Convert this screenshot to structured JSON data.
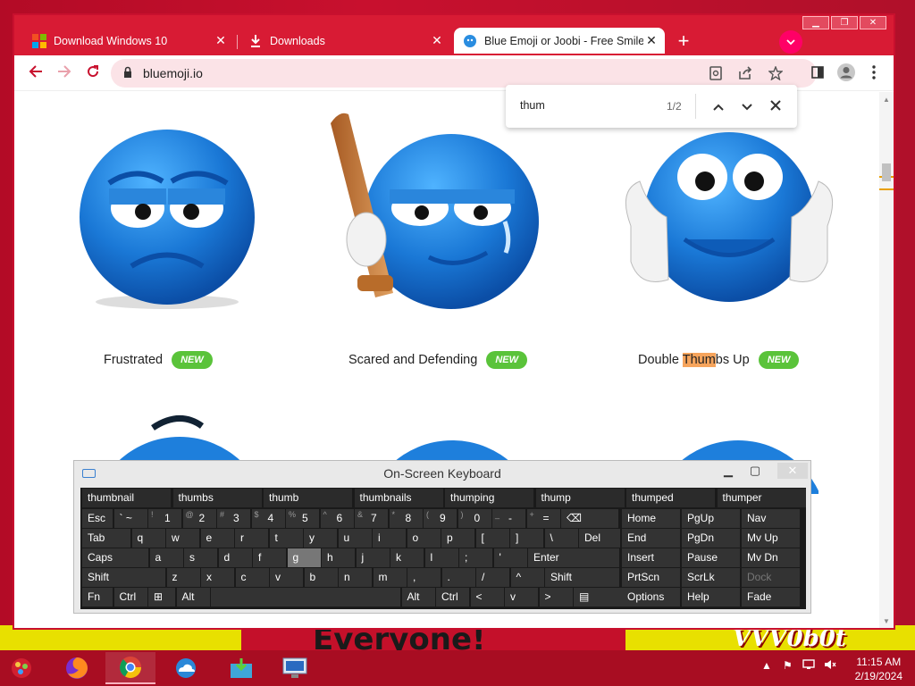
{
  "browser": {
    "tabs": [
      {
        "label": "Download Windows 10",
        "icon": "windows-logo-icon"
      },
      {
        "label": "Downloads",
        "icon": "download-icon"
      },
      {
        "label": "Blue Emoji or Joobi - Free Smiley",
        "icon": "bluemoji-icon",
        "active": true
      }
    ],
    "url": "bluemoji.io",
    "accent": "#d81b34"
  },
  "find_bar": {
    "query": "thum",
    "count": "1/2"
  },
  "page": {
    "items": [
      {
        "name": "Frustrated",
        "badge": "NEW"
      },
      {
        "name": "Scared and Defending",
        "badge": "NEW"
      },
      {
        "name_before": "Double ",
        "name_highlight": "Thum",
        "name_after": "bs Up",
        "badge": "NEW"
      }
    ]
  },
  "osk": {
    "title": "On-Screen Keyboard",
    "predictions": [
      "thumbnail",
      "thumbs",
      "thumb",
      "thumbnails",
      "thumping",
      "thump",
      "thumped",
      "thumper"
    ],
    "row1": [
      {
        "k": "Esc"
      },
      {
        "k": "` ~"
      },
      {
        "k": "1",
        "s": "!"
      },
      {
        "k": "2",
        "s": "@"
      },
      {
        "k": "3",
        "s": "#"
      },
      {
        "k": "4",
        "s": "$"
      },
      {
        "k": "5",
        "s": "%"
      },
      {
        "k": "6",
        "s": "^"
      },
      {
        "k": "7",
        "s": "&"
      },
      {
        "k": "8",
        "s": "*"
      },
      {
        "k": "9",
        "s": "("
      },
      {
        "k": "0",
        "s": ")"
      },
      {
        "k": "-",
        "s": "_"
      },
      {
        "k": "=",
        "s": "+"
      },
      {
        "k": "⌫"
      }
    ],
    "row2": [
      "Tab",
      "q",
      "w",
      "e",
      "r",
      "t",
      "y",
      "u",
      "i",
      "o",
      "p",
      "[",
      "]",
      "\\",
      "Del"
    ],
    "row3": [
      "Caps",
      "a",
      "s",
      "d",
      "f",
      "g",
      "h",
      "j",
      "k",
      "l",
      ";",
      "'",
      "Enter"
    ],
    "row4": [
      "Shift",
      "z",
      "x",
      "c",
      "v",
      "b",
      "n",
      "m",
      ",",
      ".",
      "/",
      "^",
      "Shift"
    ],
    "row5": [
      "Fn",
      "Ctrl",
      "⊞",
      "Alt",
      "",
      "Alt",
      "Ctrl",
      "<",
      "v",
      ">",
      "▤"
    ],
    "nav_keys": [
      [
        "Home",
        "PgUp",
        "Nav"
      ],
      [
        "End",
        "PgDn",
        "Mv Up"
      ],
      [
        "Insert",
        "Pause",
        "Mv Dn"
      ],
      [
        "PrtScn",
        "ScrLk",
        "Dock"
      ],
      [
        "Options",
        "Help",
        "Fade"
      ]
    ]
  },
  "desktop": {
    "banner_text": "Everyone!",
    "logo_text": "VVV0b0t"
  },
  "taskbar": {
    "apps": [
      "firefox-icon",
      "chrome-icon",
      "onedrive-icon",
      "install-icon",
      "remote-desktop-icon"
    ],
    "time": "11:15 AM",
    "date": "2/19/2024"
  }
}
